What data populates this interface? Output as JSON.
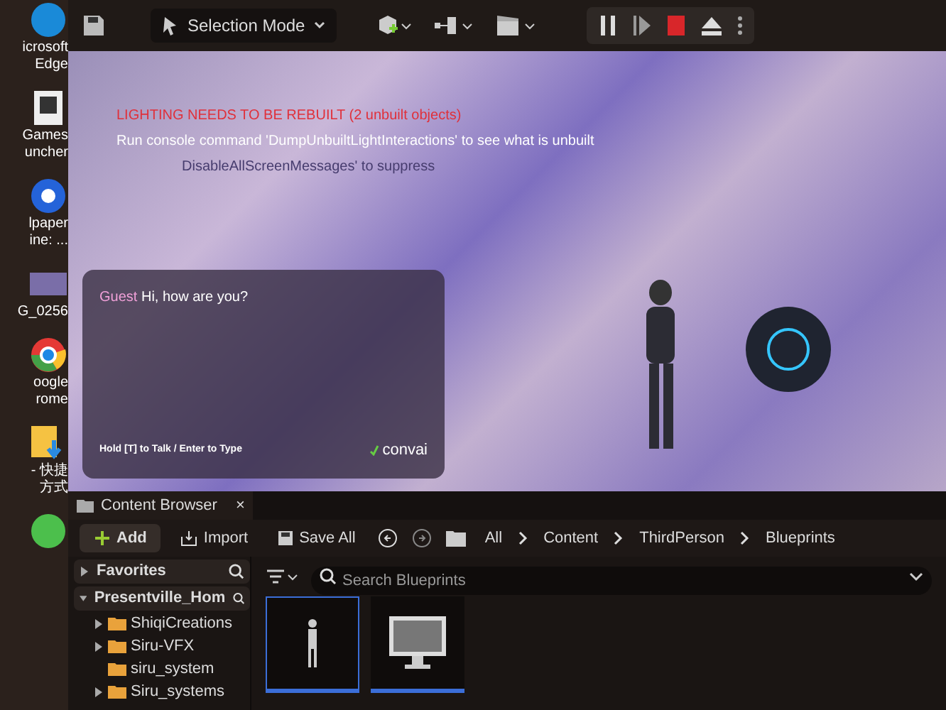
{
  "desktop_icons": [
    {
      "kind": "edge",
      "lines": [
        "icrosoft",
        "Edge"
      ]
    },
    {
      "kind": "epic",
      "lines": [
        "Games",
        "uncher"
      ]
    },
    {
      "kind": "wallpaper",
      "lines": [
        "lpaper",
        "ine: ..."
      ]
    },
    {
      "kind": "image",
      "lines": [
        "G_0256"
      ]
    },
    {
      "kind": "chrome",
      "lines": [
        "oogle",
        "rome"
      ]
    },
    {
      "kind": "shortcut",
      "lines": [
        "- 快捷",
        "方式"
      ]
    },
    {
      "kind": "chat"
    }
  ],
  "toolbar": {
    "mode": "Selection Mode"
  },
  "viewport": {
    "messages": [
      {
        "kind": "error",
        "text": "LIGHTING NEEDS TO BE REBUILT (2 unbuilt objects)"
      },
      {
        "kind": "info",
        "text": "Run console command 'DumpUnbuiltLightInteractions' to see what is unbuilt"
      },
      {
        "kind": "faded",
        "text": "DisableAllScreenMessages' to suppress"
      }
    ],
    "chat": {
      "speaker": "Guest",
      "message": "Hi, how are you?",
      "hint": "Hold [T] to Talk / Enter to Type",
      "brand": "convai"
    }
  },
  "content_browser": {
    "tab": {
      "title": "Content Browser",
      "close": "×"
    },
    "actions": [
      {
        "kind": "add",
        "label": "Add"
      },
      {
        "kind": "import",
        "label": "Import"
      },
      {
        "kind": "save",
        "label": "Save All"
      }
    ],
    "breadcrumb": [
      "All",
      "Content",
      "ThirdPerson",
      "Blueprints"
    ],
    "sidebar": [
      {
        "label": "Favorites",
        "expanded": false
      },
      {
        "label": "Presentville_Hom",
        "expanded": true,
        "children": [
          {
            "label": "ShiqiCreations",
            "expandable": true
          },
          {
            "label": "Siru-VFX",
            "expandable": true
          },
          {
            "label": "siru_system",
            "expandable": false
          },
          {
            "label": "Siru_systems",
            "expandable": true
          }
        ]
      }
    ],
    "search": {
      "placeholder": "Search Blueprints"
    },
    "assets": [
      {
        "kind": "character",
        "selected": true
      },
      {
        "kind": "game-mode",
        "selected": false
      }
    ]
  }
}
